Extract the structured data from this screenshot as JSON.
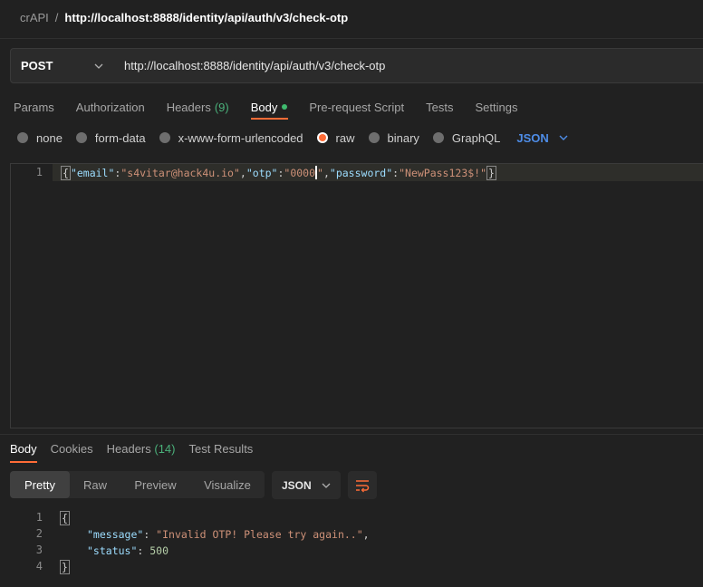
{
  "breadcrumb": {
    "collection": "crAPI",
    "separator": "/",
    "request": "http://localhost:8888/identity/api/auth/v3/check-otp"
  },
  "request": {
    "method": "POST",
    "url": "http://localhost:8888/identity/api/auth/v3/check-otp"
  },
  "request_tabs": [
    {
      "label": "Params"
    },
    {
      "label": "Authorization"
    },
    {
      "label": "Headers",
      "count": "(9)"
    },
    {
      "label": "Body",
      "active": true,
      "indicator": "green-dot"
    },
    {
      "label": "Pre-request Script"
    },
    {
      "label": "Tests"
    },
    {
      "label": "Settings"
    }
  ],
  "body_types": [
    {
      "label": "none"
    },
    {
      "label": "form-data"
    },
    {
      "label": "x-www-form-urlencoded"
    },
    {
      "label": "raw",
      "selected": true
    },
    {
      "label": "binary"
    },
    {
      "label": "GraphQL"
    }
  ],
  "body_language": "JSON",
  "editor": {
    "line_number": "1",
    "tokens": {
      "open": "{",
      "k1": "\"email\"",
      "colon": ":",
      "v1": "\"s4vitar@hack4u.io\"",
      "comma": ",",
      "k2": "\"otp\"",
      "v2a": "\"0000",
      "v2b": "\"",
      "k3": "\"password\"",
      "v3": "\"NewPass123$!\"",
      "close": "}"
    }
  },
  "response_tabs": [
    {
      "label": "Body",
      "active": true
    },
    {
      "label": "Cookies"
    },
    {
      "label": "Headers",
      "count": "(14)"
    },
    {
      "label": "Test Results"
    }
  ],
  "view_modes": [
    {
      "label": "Pretty",
      "active": true
    },
    {
      "label": "Raw"
    },
    {
      "label": "Preview"
    },
    {
      "label": "Visualize"
    }
  ],
  "response_format": "JSON",
  "response": {
    "line_numbers": [
      "1",
      "2",
      "3",
      "4"
    ],
    "open": "{",
    "message_key": "\"message\"",
    "message_value": "\"Invalid OTP! Please try again..\"",
    "status_key": "\"status\"",
    "status_value": "500",
    "colon": ": ",
    "comma": ",",
    "close": "}"
  },
  "colors": {
    "accent": "#ff6c37",
    "link": "#4e8de8",
    "count_green": "#4ab07a",
    "background": "#212121"
  }
}
